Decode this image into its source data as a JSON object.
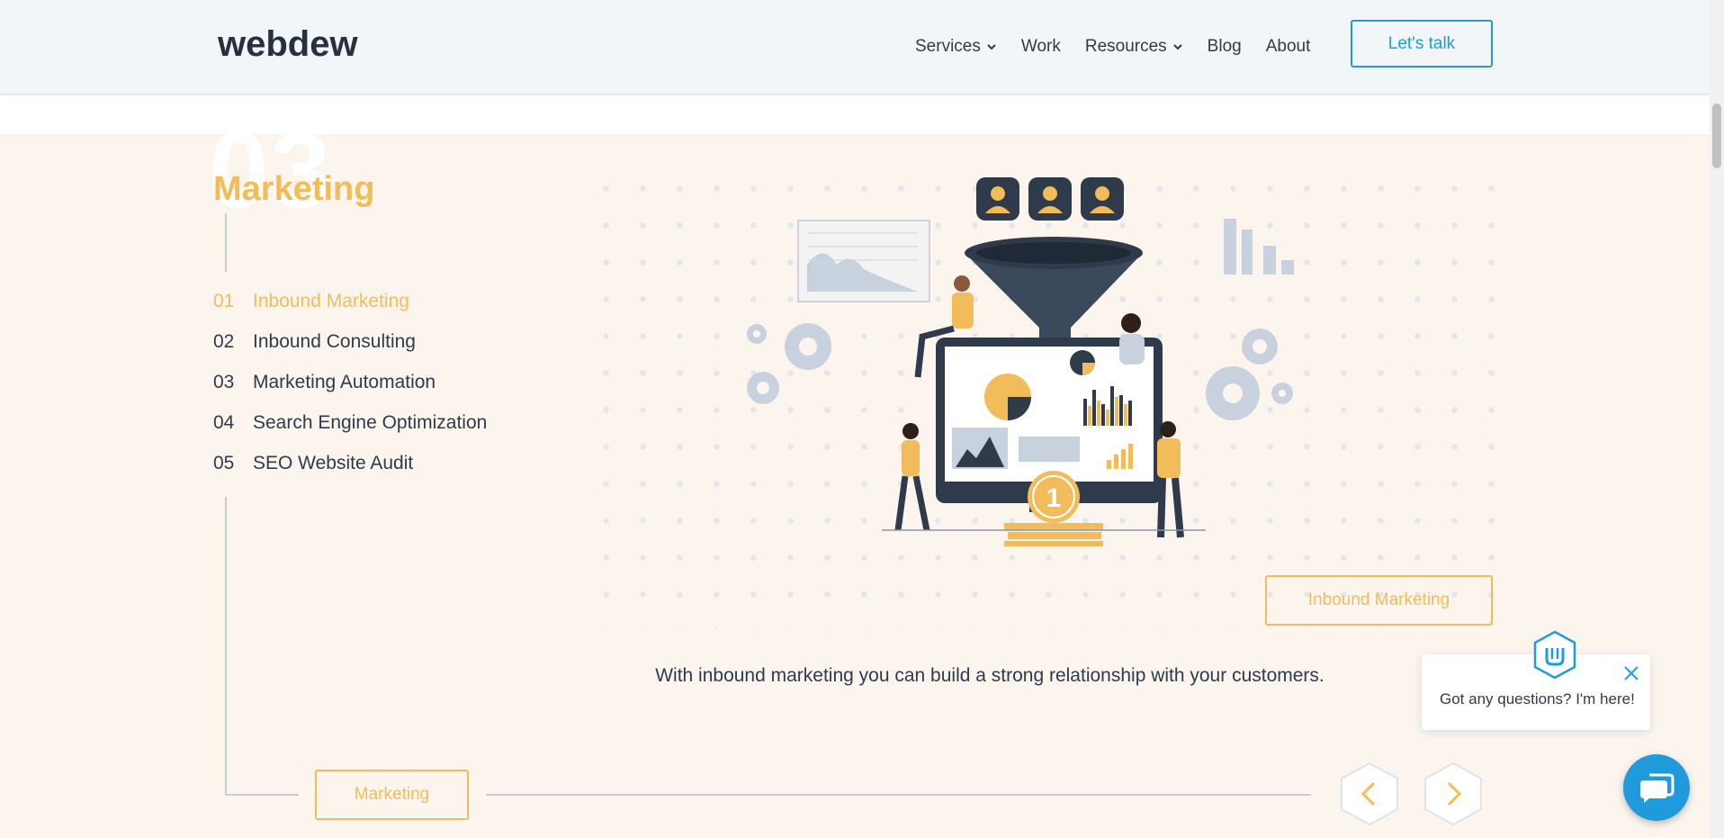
{
  "header": {
    "logo_text": "webdew",
    "nav": [
      {
        "label": "Services",
        "has_dropdown": true
      },
      {
        "label": "Work",
        "has_dropdown": false
      },
      {
        "label": "Resources",
        "has_dropdown": true
      },
      {
        "label": "Blog",
        "has_dropdown": false
      },
      {
        "label": "About",
        "has_dropdown": false
      }
    ],
    "cta_label": "Let's talk"
  },
  "section": {
    "number": "03",
    "title": "Marketing",
    "services": [
      {
        "num": "01",
        "label": "Inbound Marketing",
        "active": true
      },
      {
        "num": "02",
        "label": "Inbound Consulting",
        "active": false
      },
      {
        "num": "03",
        "label": "Marketing Automation",
        "active": false
      },
      {
        "num": "04",
        "label": "Search Engine Optimization",
        "active": false
      },
      {
        "num": "05",
        "label": "SEO Website Audit",
        "active": false
      }
    ],
    "tag_label": "Inbound Marketing",
    "description": "With inbound marketing you can build a strong relationship with your customers.",
    "category_label": "Marketing",
    "illustration_badge": "1"
  },
  "chat": {
    "message": "Got any questions? I'm here!"
  },
  "colors": {
    "accent_blue": "#1f9bdc",
    "accent_yellow": "#f2bc5b",
    "section_bg": "#fbf5ee",
    "header_bg": "#f2f6f9",
    "text_dark": "#2f3b4a"
  }
}
